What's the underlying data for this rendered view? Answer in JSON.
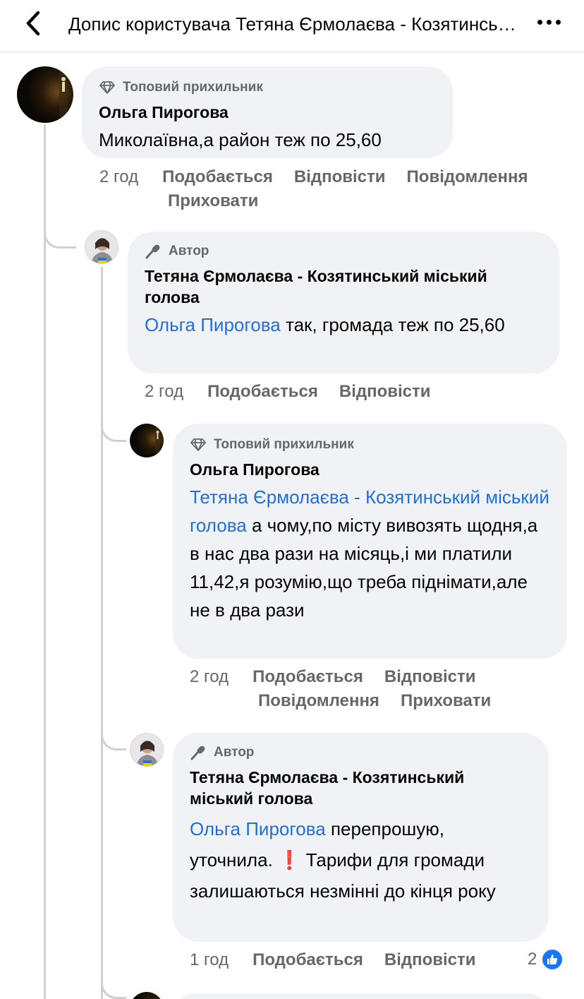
{
  "header": {
    "title": "Допис користувача Тетяна Єрмолаєва - Козятинський міський голова"
  },
  "comments": [
    {
      "badge": "Топовий прихильник",
      "author": "Ольга Пирогова",
      "text": "Миколаївна,а район теж по 25,60",
      "time": "2 год",
      "actions": [
        "Подобається",
        "Відповісти",
        "Повідомлення",
        "Приховати"
      ]
    },
    {
      "badge": "Автор",
      "author": "Тетяна Єрмолаєва - Козятинський міський голова",
      "mention": "Ольга Пирогова",
      "text": "так, громада теж по 25,60",
      "time": "2 год",
      "actions": [
        "Подобається",
        "Відповісти"
      ]
    },
    {
      "badge": "Топовий прихильник",
      "author": "Ольга Пирогова",
      "mention": "Тетяна Єрмолаєва - Козятинський міський голова",
      "text": "а чому,по місту вивозять щодня,а в нас два рази на місяць,і ми платили 11,42,я розумію,що треба піднімати,але не в два рази",
      "time": "2 год",
      "actions": [
        "Подобається",
        "Відповісти",
        "Повідомлення",
        "Приховати"
      ]
    },
    {
      "badge": "Автор",
      "author": "Тетяна Єрмолаєва - Козятинський міський голова",
      "mention": "Ольга Пирогова",
      "text_a": "перепрошую,",
      "text_b": "уточнила.",
      "emoji": "❗",
      "text_c": "Тарифи для громади залишаються незмінні до кінця року",
      "time": "1 год",
      "actions": [
        "Подобається",
        "Відповісти"
      ],
      "reaction_count": "2"
    }
  ],
  "icons": {
    "back": "chevron-left-icon",
    "more": "more-horizontal-icon",
    "top_fan": "diamond-icon",
    "author": "microphone-icon",
    "like": "thumbs-up-icon"
  },
  "colors": {
    "bubble": "#f0f2f5",
    "mention": "#216fdb",
    "meta": "#65676b",
    "like": "#1877f2"
  }
}
